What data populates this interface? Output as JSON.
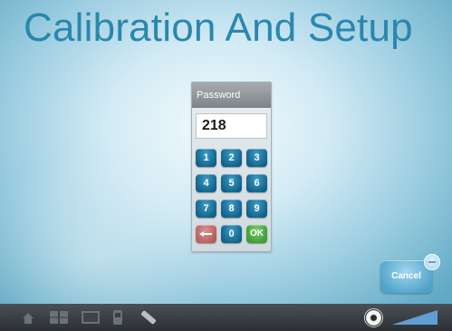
{
  "title": "Calibration And Setup",
  "keypad": {
    "header": "Password",
    "value": "218",
    "keys": [
      "1",
      "2",
      "3",
      "4",
      "5",
      "6",
      "7",
      "8",
      "9",
      "0",
      "OK"
    ],
    "back_key_icon": "backspace-arrow-icon"
  },
  "cancel": {
    "label": "Cancel",
    "bubble_icon": "minus-bubble-icon"
  },
  "bottombar": {
    "icons": [
      "home-icon",
      "grid-icon",
      "monitor-icon",
      "device-icon",
      "pen-icon",
      "disc-icon",
      "volume-icon"
    ]
  },
  "colors": {
    "title": "#2a87ad",
    "key_blue": "#1a73a0",
    "key_back": "#c27070",
    "key_ok": "#52b544",
    "cancel": "#6bb6d8",
    "bar": "#3a3f44"
  }
}
